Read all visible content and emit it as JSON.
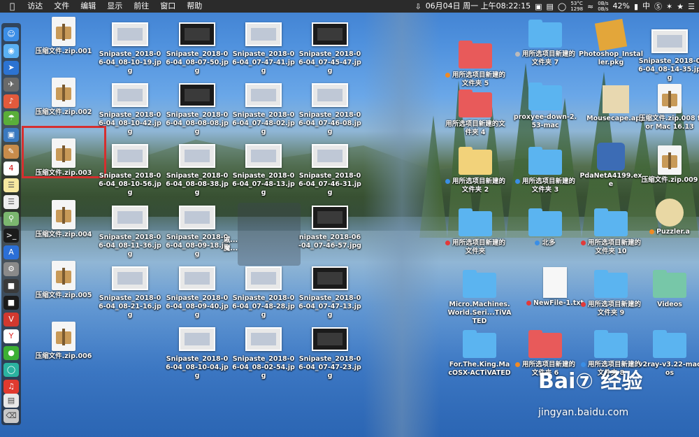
{
  "menubar": {
    "apple": "",
    "items": [
      "访达",
      "文件",
      "编辑",
      "显示",
      "前往",
      "窗口",
      "帮助"
    ],
    "clock": "06月04日 周一 上午08:22:15",
    "temp": "53°C",
    "rpm": "1298",
    "net_up": "0B/s",
    "net_down": "0B/s",
    "battery": "42%",
    "input": "中"
  },
  "col1": [
    "压缩文件.zip.001",
    "压缩文件.zip.002",
    "压缩文件.zip.003",
    "压缩文件.zip.004",
    "压缩文件.zip.005",
    "压缩文件.zip.006"
  ],
  "col2": [
    "Snipaste_2018-06-04_08-10-19.jpg",
    "Snipaste_2018-06-04_08-10-42.jpg",
    "Snipaste_2018-06-04_08-10-56.jpg",
    "Snipaste_2018-06-04_08-11-36.jpg",
    "Snipaste_2018-06-04_08-21-16.jpg"
  ],
  "col3": [
    "Snipaste_2018-06-04_08-07-50.jpg",
    "Snipaste_2018-06-04_08-08-08.jpg",
    "Snipaste_2018-06-04_08-08-38.jpg",
    "Snipaste_2018-06-04_08-09-18.jpg",
    "Snipaste_2018-06-04_08-09-40.jpg",
    "Snipaste_2018-06-04_08-10-04.jpg"
  ],
  "col4": [
    "Snipaste_2018-06-04_07-47-41.jpg",
    "Snipaste_2018-06-04_07-48-02.jpg",
    "Snipaste_2018-06-04_07-48-13.jpg",
    "戚...\n魔...",
    "Snipaste_2018-06-04_07-48-28.jpg",
    "Snipaste_2018-06-04_08-02-54.jpg"
  ],
  "col5": [
    "Snipaste_2018-06-04_07-45-47.jpg",
    "Snipaste_2018-06-04_07-46-08.jpg",
    "Snipaste_2018-06-04_07-46-31.jpg",
    "nipaste_2018-06-04_07-46-57.jpg",
    "Snipaste_2018-06-04_07-47-13.jpg",
    "Snipaste_2018-06-04_07-47-23.jpg"
  ],
  "right": {
    "r1": [
      "用所选项目新建的文件夹 5",
      "用所选项目新建的文件夹 7",
      "Photoshop_Installer.pkg",
      "Snipaste_2018-06-04_08-14-35.jpg"
    ],
    "r2": [
      "用所选项目新建的文件夹 4",
      "proxyee-down-2.53-mac",
      "Mousecape.app",
      "压缩文件.zip.008 for Mac 16.13"
    ],
    "r3": [
      "用所选项目新建的文件夹 2",
      "用所选项目新建的文件夹 3",
      "PdaNetA4199.exe",
      "压缩文件.zip.009"
    ],
    "r4": [
      "用所选项目新建的文件夹",
      "北多",
      "用所选项目新建的文件夹 10",
      "Puzzler.a"
    ],
    "r5": [
      "Micro.Machines.World.Seri...TiVATED",
      "NewFile-1.txt",
      "用所选项目新建的文件夹 9",
      "Videos"
    ],
    "r6": [
      "For.The.King.MacOSX-ACTiVATED",
      "用所选项目新建的文件夹 6",
      "用所选项目新建的文件夹 8",
      "v2ray-v3.22-macos"
    ]
  },
  "watermark": {
    "main": "Bai⑦ 经验",
    "url": "jingyan.baidu.com"
  },
  "colors": {
    "highlight": "#d62f2f",
    "folder_blue": "#5bb4f0",
    "folder_red": "#e85a5a"
  }
}
